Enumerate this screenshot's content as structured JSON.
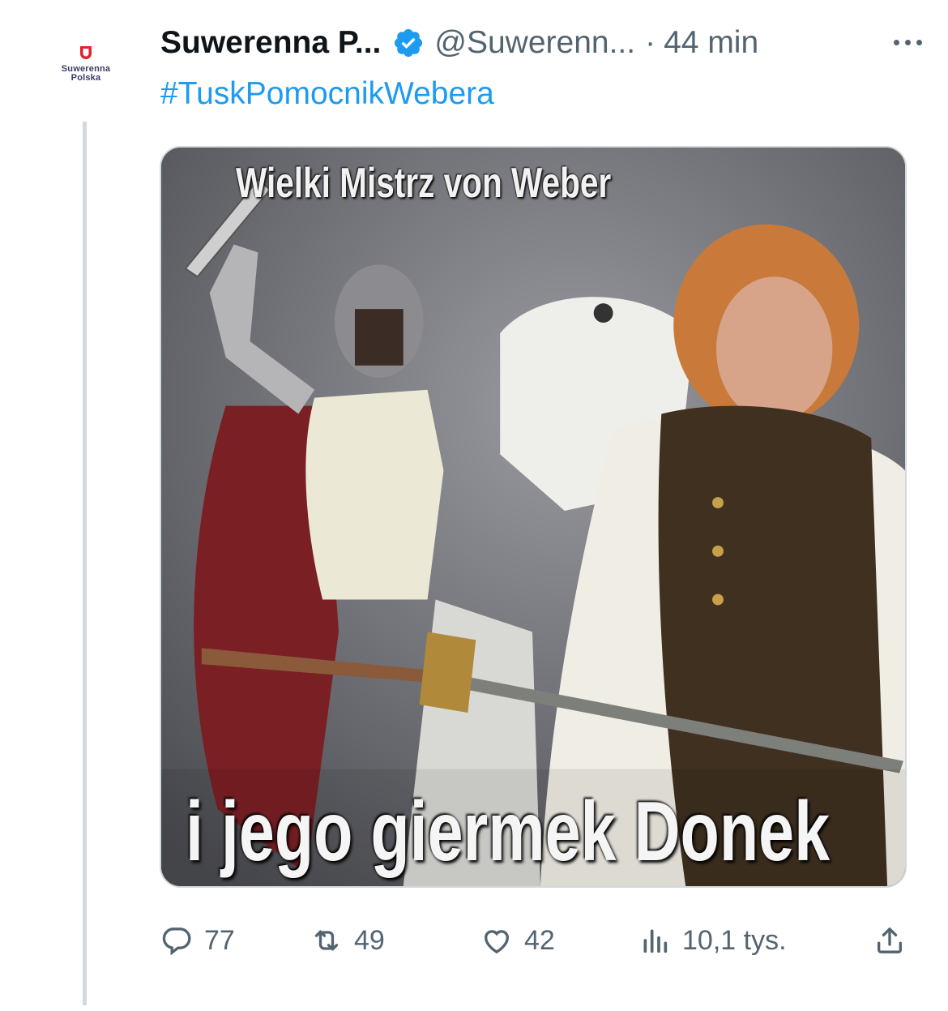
{
  "tweet": {
    "author_name": "Suwerenna P...",
    "handle": "@Suwerenn...",
    "separator": "·",
    "time": "44 min",
    "hashtag": "#TuskPomocnikWebera",
    "avatar": {
      "line1": "Suwerenna",
      "line2": "Polska",
      "accent": "#e3212b"
    },
    "verified_color": "#1d9bf0"
  },
  "media": {
    "caption_top": "Wielki Mistrz von Weber",
    "caption_bottom": "i jego giermek Donek"
  },
  "actions": {
    "replies": "77",
    "retweets": "49",
    "likes": "42",
    "views": "10,1 tys."
  },
  "icons": [
    "verified-badge-icon",
    "more-icon",
    "reply-icon",
    "retweet-icon",
    "like-icon",
    "views-icon",
    "share-icon"
  ]
}
